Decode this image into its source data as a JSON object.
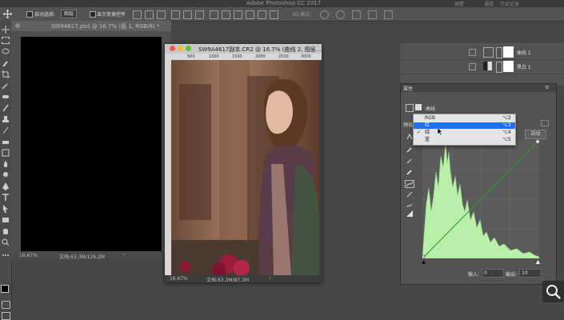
{
  "app": {
    "title": "Adobe Photoshop CC 2017"
  },
  "options_bar": {
    "auto_select_label": "自动选择:",
    "auto_select_value": "图层",
    "show_transform_label": "显示变换控件",
    "mode_3d_label": "3D 模式:"
  },
  "top_right_tabs": [
    "调整",
    "通道",
    "历史记录"
  ],
  "doc1": {
    "tab_title": "SW94617.psd @ 16.7% (组 1, RGB/8) *",
    "zoom": "16.67%",
    "doc_size": "文档:63.3M/126.2M"
  },
  "doc2": {
    "title": "SW9A4617副本.CR2 @ 16.7% (曲线 2, 图层...",
    "ruler_ticks": [
      "500",
      "1000",
      "1500",
      "2000",
      "2500",
      "3000"
    ],
    "zoom": "16.67%",
    "doc_size": "文档:63.3M/87.3M"
  },
  "layers": [
    {
      "name": "曲线 1"
    },
    {
      "name": "黑白 1"
    }
  ],
  "properties": {
    "header": "属性",
    "title": "曲线",
    "preset_label": "预设:",
    "auto_button": "自动",
    "input_label": "输入:",
    "input_value": "0",
    "output_label": "输出:",
    "output_value": "10",
    "channel_menu": [
      {
        "label": "RGB",
        "shortcut": "⌥2",
        "checked": false,
        "selected": false
      },
      {
        "label": "红",
        "shortcut": "⌥3",
        "checked": false,
        "selected": true
      },
      {
        "label": "绿",
        "shortcut": "⌥4",
        "checked": true,
        "selected": false
      },
      {
        "label": "蓝",
        "shortcut": "⌥5",
        "checked": false,
        "selected": false
      }
    ]
  },
  "colors": {
    "ui_bg": "#474747",
    "panel": "#535353",
    "histogram": "#b9efa8",
    "selection": "#1f6ff0"
  },
  "icons": [
    "move-icon",
    "zoom-icon"
  ]
}
